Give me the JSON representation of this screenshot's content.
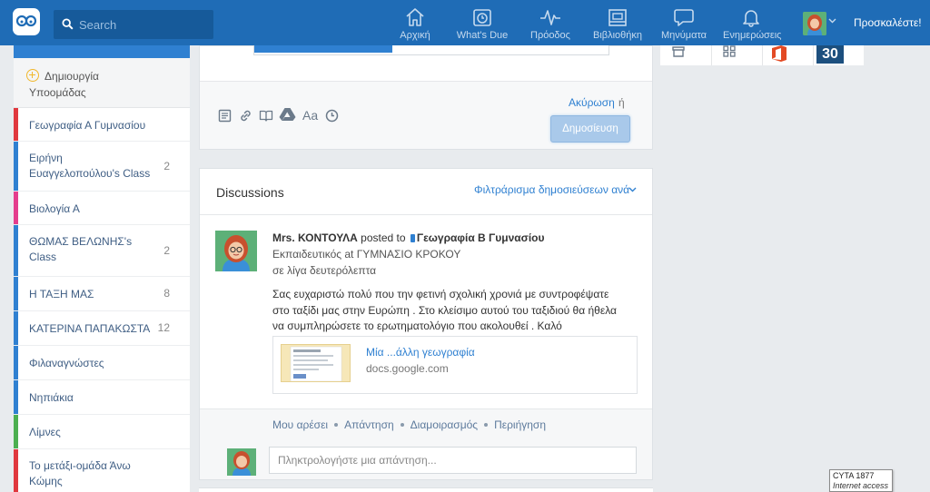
{
  "header": {
    "search_placeholder": "Search",
    "nav": [
      {
        "label": "Αρχική",
        "icon": "home-icon"
      },
      {
        "label": "What's Due",
        "icon": "alarm-clock-icon"
      },
      {
        "label": "Πρόοδος",
        "icon": "pulse-icon"
      },
      {
        "label": "Βιβλιοθήκη",
        "icon": "library-icon"
      },
      {
        "label": "Μηνύματα",
        "icon": "message-icon"
      },
      {
        "label": "Ενημερώσεις",
        "icon": "bell-icon"
      }
    ],
    "invite_label": "Προσκαλέστε!"
  },
  "sidebar": {
    "create_subgroup": "Δημιουργία Υποομάδας",
    "groups": [
      {
        "name": "Γεωγραφία Α Γυμνασίου",
        "count": "",
        "color": "#e0383e"
      },
      {
        "name": "Ειρήνη Ευαγγελοπούλου's Class",
        "count": "2",
        "color": "#2f80d1"
      },
      {
        "name": "Βιολογία Α",
        "count": "",
        "color": "#e43d8d"
      },
      {
        "name": "ΘΩΜΑΣ ΒΕΛΩΝΗΣ's Class",
        "count": "2",
        "color": "#2f80d1"
      },
      {
        "name": "Η ΤΑΞΗ ΜΑΣ",
        "count": "8",
        "color": "#2f80d1"
      },
      {
        "name": "ΚΑΤΕΡΙΝΑ ΠΑΠΑΚΩΣΤΑ",
        "count": "12",
        "color": "#2f80d1"
      },
      {
        "name": "Φιλαναγνώστες",
        "count": "",
        "color": "#2f80d1"
      },
      {
        "name": "Νηπιάκια",
        "count": "",
        "color": "#2f80d1"
      },
      {
        "name": "Λίμνες",
        "count": "",
        "color": "#4caf50"
      },
      {
        "name": "Το μετάξι-ομάδα Άνω Κώμης",
        "count": "",
        "color": "#e0383e"
      }
    ]
  },
  "composer": {
    "cancel_label": "Ακύρωση",
    "or_label": "ή",
    "post_label": "Δημοσίευση",
    "font_tool_label": "Aa"
  },
  "discussions": {
    "title": "Discussions",
    "filter_label": "Φιλτράρισμα δημοσιεύσεων ανά",
    "post": {
      "author": "Mrs. ΚΟΝΤΟΥΛΑ",
      "posted_to": "posted to",
      "group": "Γεωγραφία Β Γυμνασίου",
      "role": "Εκπαιδευτικός at ΓΥΜΝΑΣΙΟ ΚΡΟΚΟΥ",
      "time": "σε λίγα δευτερόλεπτα",
      "body": "Σας ευχαριστώ πολύ που την φετινή σχολική χρονιά με συντροφέψατε στο ταξίδι μας στην Ευρώπη . Στο κλείσιμο αυτού του ταξιδιού θα ήθελα να συμπληρώσετε το ερωτηματολόγιο που ακολουθεί . Καλό καλοκαίρι!!!!!!",
      "link_title": "Μία ...άλλη γεωγραφία",
      "link_url": "docs.google.com",
      "actions": [
        "Μου αρέσει",
        "Απάντηση",
        "Διαμοιρασμός",
        "Περιήγηση"
      ],
      "reply_placeholder": "Πληκτρολογήστε μια απάντηση..."
    }
  },
  "apps": {
    "calendar_day": "30"
  },
  "tooltip": {
    "line1": "CYTA 1877",
    "line2": "Internet access"
  }
}
